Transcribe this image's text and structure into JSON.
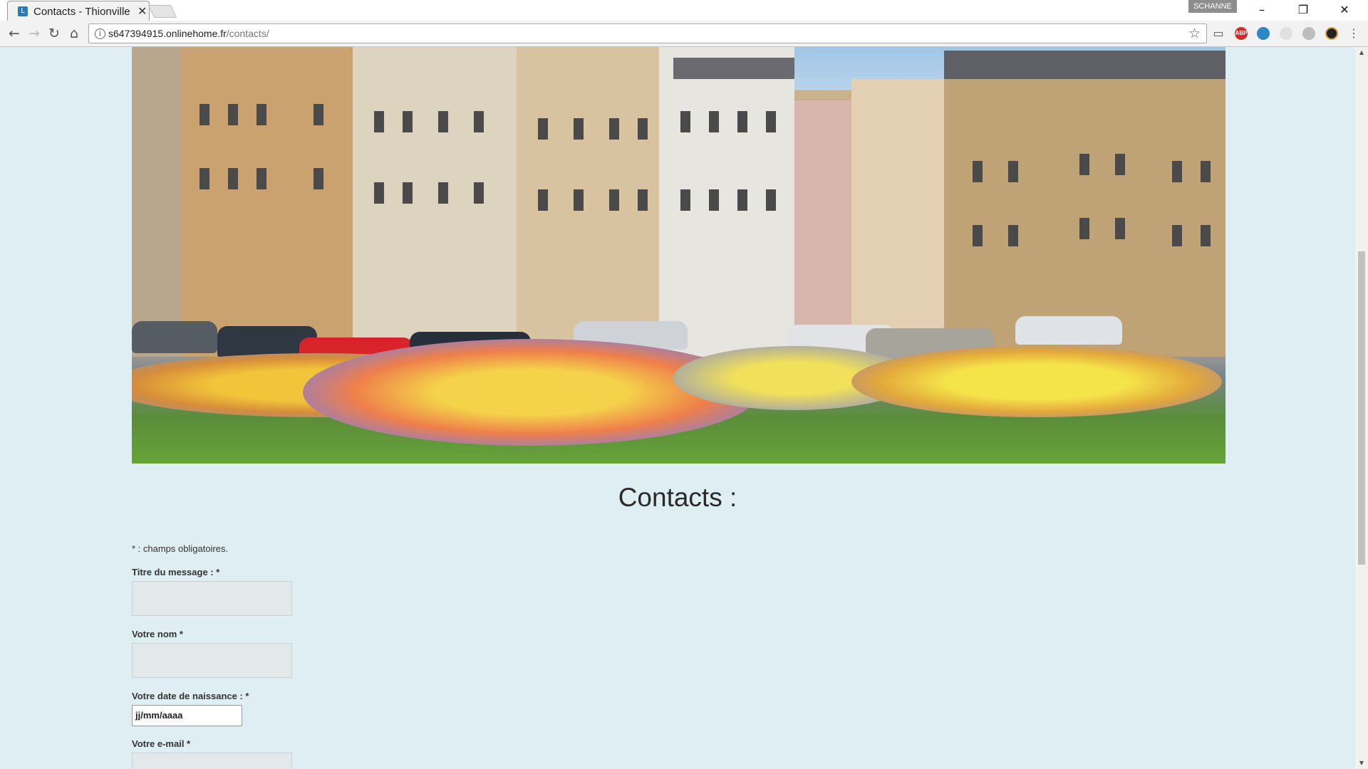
{
  "browser": {
    "tab_title": "Contacts - Thionville",
    "tab_close": "✕",
    "profile_name": "SCHANNE",
    "url_host": "s647394915.onlinehome.fr",
    "url_path": "/contacts/",
    "icons": [
      "back-icon",
      "forward-icon",
      "reload-icon",
      "home-icon",
      "info-icon",
      "star-icon",
      "cast-icon",
      "adblock-icon",
      "extension-icon",
      "extension-icon",
      "extension-icon",
      "extension-icon",
      "menu-icon"
    ],
    "ext_abp_label": "ABP"
  },
  "page": {
    "title": "Contacts :",
    "required_note": "* : champs obligatoires.",
    "fields": {
      "title_label": "Titre du message : *",
      "name_label": "Votre nom *",
      "birthdate_label": "Votre date de naissance : *",
      "birthdate_placeholder": "jj/mm/aaaa",
      "email_label": "Votre e-mail *"
    }
  }
}
